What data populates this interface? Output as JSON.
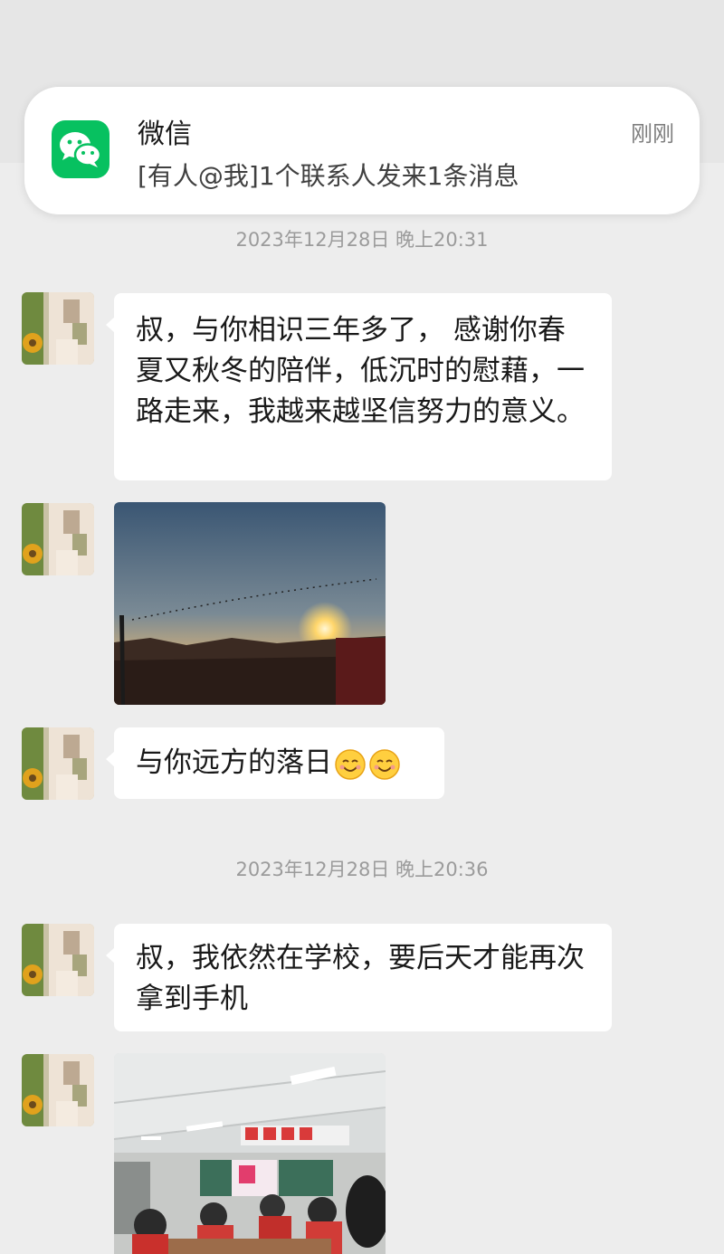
{
  "notification": {
    "app_name": "微信",
    "message": "[有人@我]1个联系人发来1条消息",
    "time": "刚刚"
  },
  "chat": {
    "timestamps": [
      "2023年12月28日 晚上20:31",
      "2023年12月28日 晚上20:36"
    ],
    "messages": [
      {
        "type": "text",
        "text": "叔，与你相识三年多了， 感谢你春夏又秋冬的陪伴，低沉时的慰藉，一路走来，我越来越坚信努力的意义。"
      },
      {
        "type": "image",
        "icon": "sunset-photo"
      },
      {
        "type": "text",
        "text": "与你远方的落日",
        "emojis": [
          "smiling-face-emoji",
          "smiling-face-emoji"
        ]
      },
      {
        "type": "text",
        "text": "叔，我依然在学校，要后天才能再次拿到手机"
      },
      {
        "type": "image",
        "icon": "classroom-photo"
      }
    ]
  },
  "colors": {
    "background": "#ededed",
    "bubble": "#ffffff",
    "wechat_green": "#07c160"
  }
}
